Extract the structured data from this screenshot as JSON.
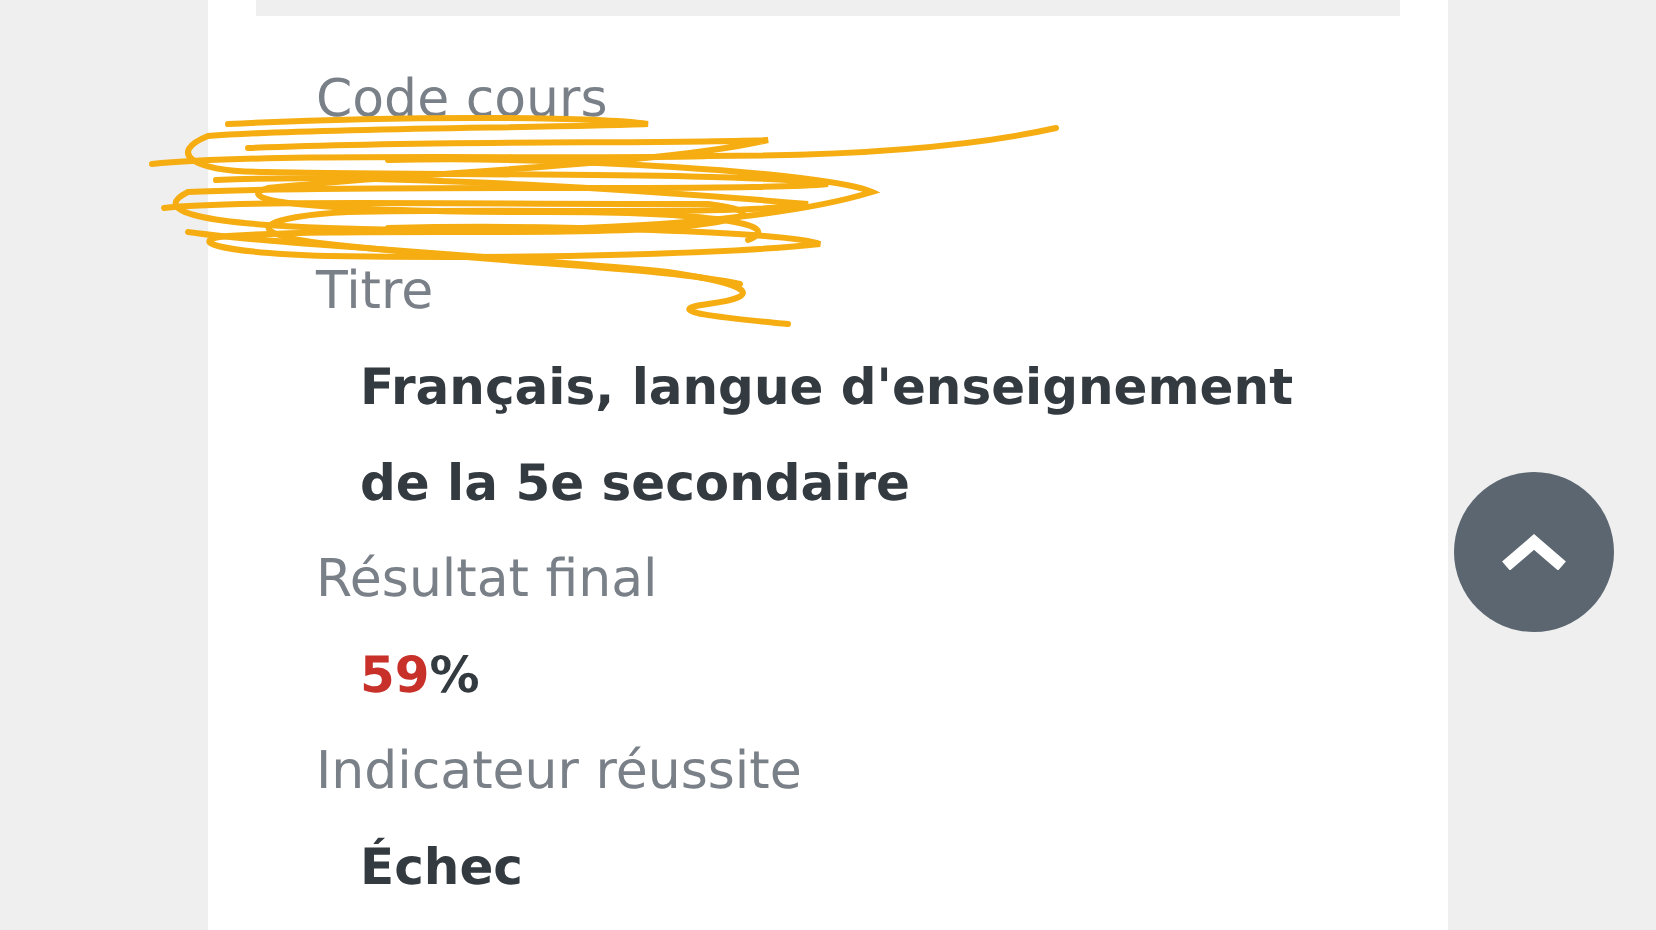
{
  "fields": [
    {
      "kind": "text",
      "label": "Code cours"
    },
    {
      "kind": "text",
      "label": "Titre",
      "value": "Français, langue d'enseignement de la 5e secondaire"
    },
    {
      "kind": "percent",
      "label": "Résultat final",
      "value": "59",
      "unit": "%"
    },
    {
      "kind": "text",
      "label": "Indicateur réussite",
      "value": "Échec"
    }
  ]
}
